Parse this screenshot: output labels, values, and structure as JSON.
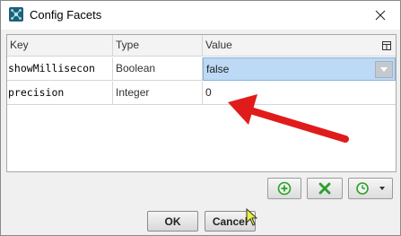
{
  "window": {
    "title": "Config Facets",
    "icon": "app-icon",
    "close_icon": "close-icon"
  },
  "table": {
    "columns": [
      "Key",
      "Type",
      "Value"
    ],
    "column_menu_icon": "column-menu-icon",
    "rows": [
      {
        "key": "showMillisecon",
        "type": "Boolean",
        "value": "false",
        "selected": true
      },
      {
        "key": "precision",
        "type": "Integer",
        "value": "0",
        "selected": false
      }
    ]
  },
  "toolbar": {
    "add_icon": "add-icon",
    "remove_icon": "remove-icon",
    "history_icon": "history-icon"
  },
  "buttons": {
    "ok": "OK",
    "cancel": "Cancel"
  },
  "colors": {
    "selection": "#bcd9f5",
    "annotation_arrow": "#e01b1b",
    "icon_green": "#2e9d2e"
  }
}
